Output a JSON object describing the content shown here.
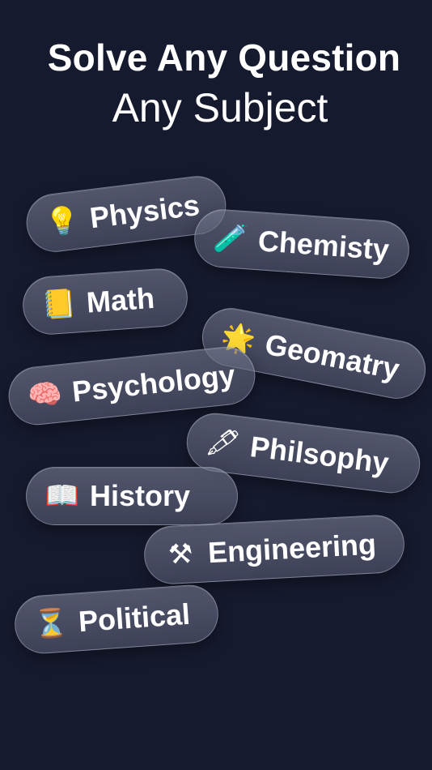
{
  "header": {
    "title": "Solve Any Question",
    "subtitle": "Any Subject"
  },
  "subjects": [
    {
      "label": "Physics",
      "icon": "💡",
      "icon_name": "lightbulb-icon"
    },
    {
      "label": "Chemisty",
      "icon": "🧪",
      "icon_name": "test-tube-icon"
    },
    {
      "label": "Math",
      "icon": "📒",
      "icon_name": "notebook-icon"
    },
    {
      "label": "Geomatry",
      "icon": "🌟",
      "icon_name": "glowing-star-icon"
    },
    {
      "label": "Psychology",
      "icon": "🧠",
      "icon_name": "brain-icon"
    },
    {
      "label": "Philsophy",
      "icon": "🖋",
      "icon_name": "fountain-pen-icon"
    },
    {
      "label": "History",
      "icon": "📖",
      "icon_name": "open-book-icon"
    },
    {
      "label": "Engineering",
      "icon": "⚒",
      "icon_name": "hammer-and-pick-icon"
    },
    {
      "label": "Political",
      "icon": "⏳",
      "icon_name": "hourglass-icon"
    }
  ],
  "colors": {
    "background": "#161a2e",
    "pill_fill": "#6e7288",
    "text": "#ffffff"
  }
}
